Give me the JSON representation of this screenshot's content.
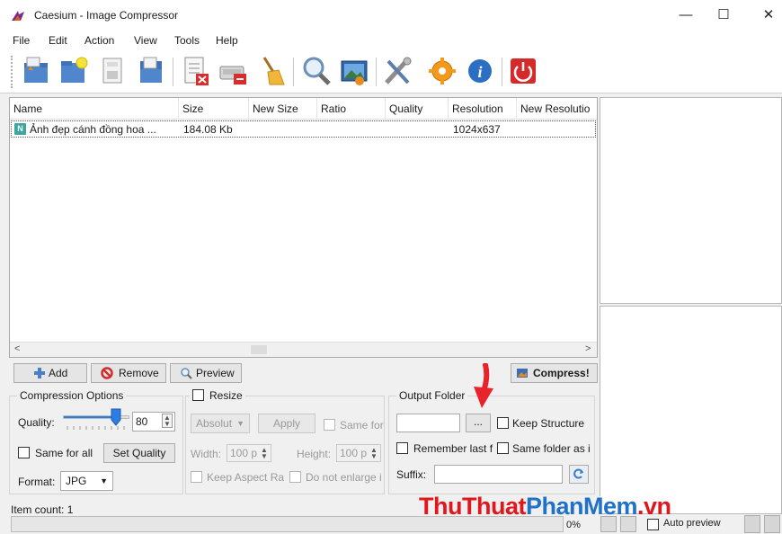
{
  "window": {
    "title": "Caesium - Image Compressor",
    "controls": {
      "minimize": "—",
      "maximize": "☐",
      "close": "✕"
    }
  },
  "menu": [
    "File",
    "Edit",
    "Action",
    "View",
    "Tools",
    "Help"
  ],
  "toolbar": {
    "buttons": [
      "open-folder-icon",
      "add-pictures-icon",
      "save-list-icon",
      "import-list-icon",
      "remove-items-icon",
      "clear-list-icon",
      "broom-icon",
      "search-icon",
      "preview-image-icon",
      "tools-icon",
      "settings-gear-icon",
      "info-icon",
      "power-icon"
    ]
  },
  "file_list": {
    "columns": [
      "Name",
      "Size",
      "New Size",
      "Ratio",
      "Quality",
      "Resolution",
      "New Resolutio"
    ],
    "rows": [
      {
        "badge": "N",
        "name": "Ảnh đẹp cánh đồng hoa ...",
        "size": "184.08 Kb",
        "new_size": "",
        "ratio": "",
        "quality": "",
        "resolution": "1024x637",
        "new_resolution": ""
      }
    ],
    "scroll_left": "<",
    "scroll_right": ">"
  },
  "actions": {
    "add": "Add",
    "remove": "Remove",
    "preview": "Preview",
    "compress": "Compress!"
  },
  "compression": {
    "title": "Compression Options",
    "quality_label": "Quality:",
    "quality_value": "80",
    "quality_fraction": 0.8,
    "same_for_all": "Same for all",
    "set_quality": "Set Quality",
    "format_label": "Format:",
    "format_value": "JPG"
  },
  "resize": {
    "title": "Resize",
    "mode": "Absolut",
    "apply": "Apply",
    "same_for": "Same for",
    "width_label": "Width:",
    "width_value": "100 p",
    "height_label": "Height:",
    "height_value": "100 p",
    "keep_aspect": "Keep Aspect Ra",
    "no_enlarge": "Do not enlarge i"
  },
  "output": {
    "title": "Output Folder",
    "path_value": "",
    "browse": "...",
    "keep_structure": "Keep Structure",
    "remember_last": "Remember last f",
    "same_folder": "Same folder as i",
    "suffix_label": "Suffix:",
    "suffix_value": ""
  },
  "status": {
    "item_count": "Item count: 1",
    "progress_percent": "0%",
    "auto_preview": "Auto preview"
  },
  "watermark": {
    "part1": "ThuThuat",
    "part2": "PhanMem",
    "part3": ".vn"
  },
  "colors": {
    "accent": "#2d7de0",
    "watermark_red": "#e0181c",
    "watermark_blue": "#1f72c8"
  }
}
